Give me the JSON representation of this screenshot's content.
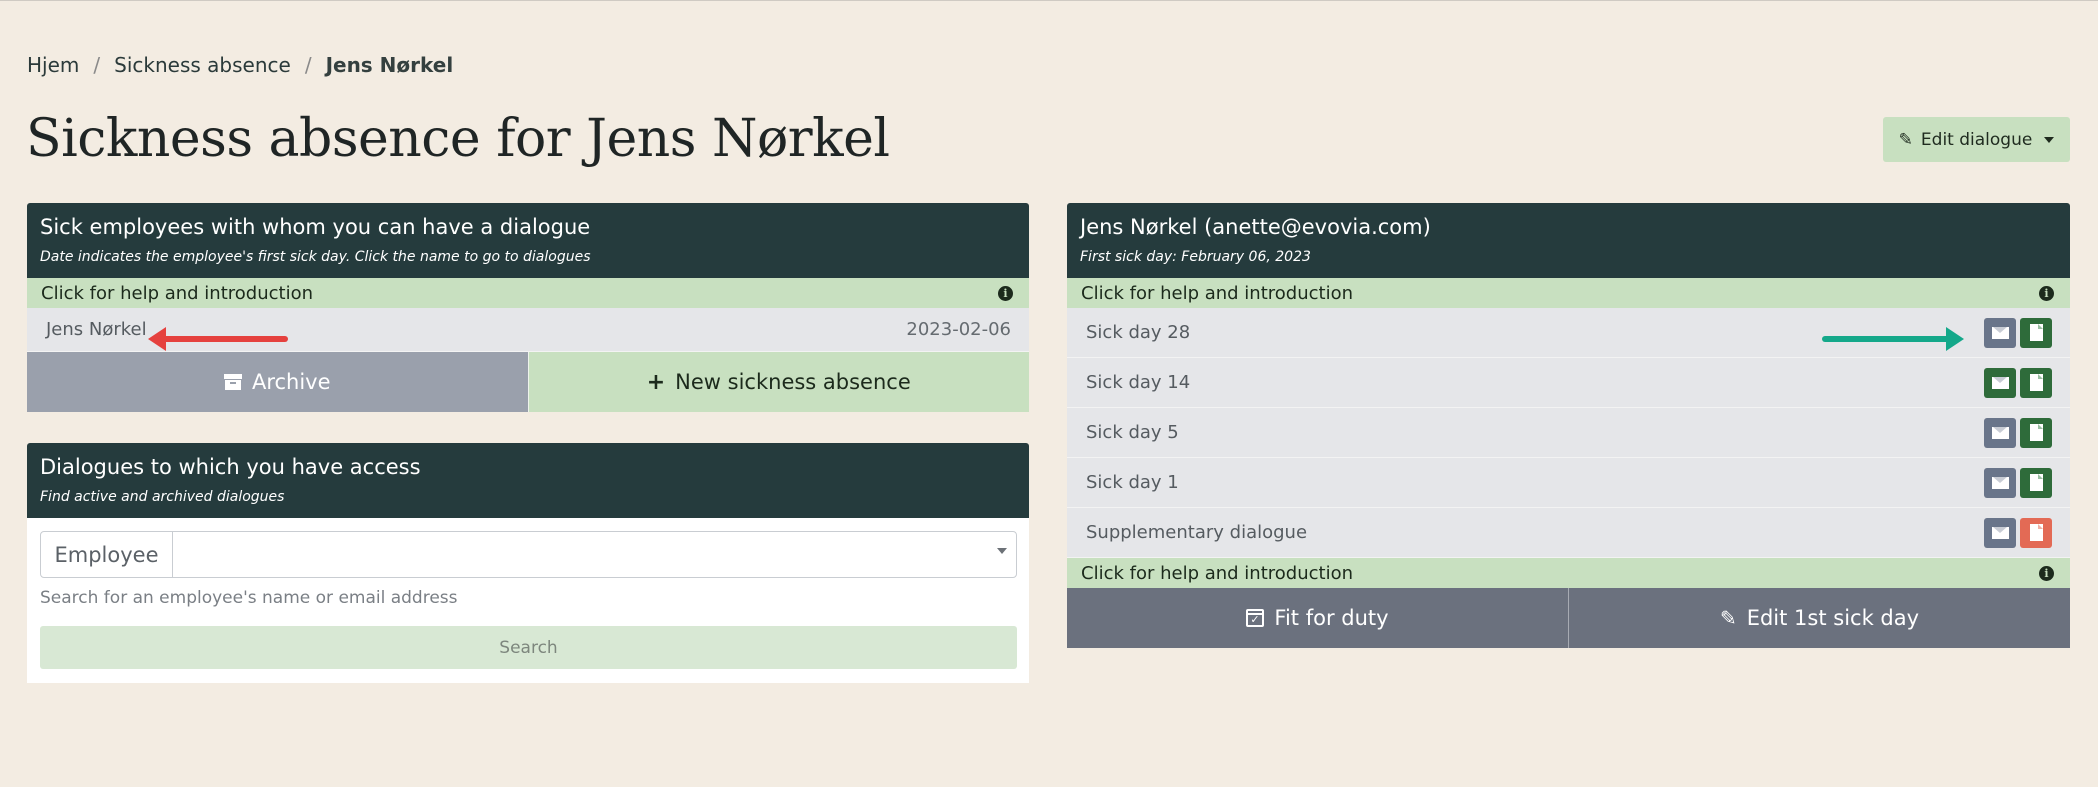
{
  "breadcrumb": {
    "home": "Hjem",
    "section": "Sickness absence",
    "current": "Jens Nørkel"
  },
  "page_title": "Sickness absence for Jens Nørkel",
  "edit_dialogue_label": "Edit dialogue",
  "sick_employees": {
    "title": "Sick employees with whom you can have a dialogue",
    "subtitle": "Date indicates the employee's first sick day. Click the name to go to dialogues",
    "help_label": "Click for help and introduction",
    "employees": [
      {
        "name": "Jens Nørkel",
        "date": "2023-02-06"
      }
    ],
    "archive_label": "Archive",
    "new_label": "New sickness absence"
  },
  "dialogues": {
    "title": "Dialogues to which you have access",
    "subtitle": "Find active and archived dialogues",
    "employee_label": "Employee",
    "helper": "Search for an employee's name or email address",
    "search_label": "Search"
  },
  "employee_card": {
    "title": "Jens Nørkel (anette@evovia.com)",
    "subtitle": "First sick day: February 06, 2023",
    "help_label": "Click for help and introduction",
    "help_label_bottom": "Click for help and introduction",
    "rows": [
      {
        "label": "Sick day 28",
        "mail_state": "grey",
        "doc_state": "green"
      },
      {
        "label": "Sick day 14",
        "mail_state": "green",
        "doc_state": "green"
      },
      {
        "label": "Sick day 5",
        "mail_state": "grey",
        "doc_state": "green"
      },
      {
        "label": "Sick day 1",
        "mail_state": "grey",
        "doc_state": "green"
      },
      {
        "label": "Supplementary dialogue",
        "mail_state": "grey",
        "doc_state": "red"
      }
    ],
    "fit_label": "Fit for duty",
    "edit_first_label": "Edit 1st sick day"
  },
  "colors": {
    "background": "#f3ece2",
    "header": "#253b3d",
    "help": "#c8e0c0",
    "annotation_red": "#e5413e",
    "annotation_green": "#14a88a"
  },
  "icons": {
    "info": "info-icon",
    "archive": "archive-icon",
    "plus": "plus-icon",
    "mail": "envelope-icon",
    "document": "document-icon",
    "calendar": "calendar-check-icon",
    "edit": "edit-icon",
    "pencil": "pencil-icon"
  }
}
